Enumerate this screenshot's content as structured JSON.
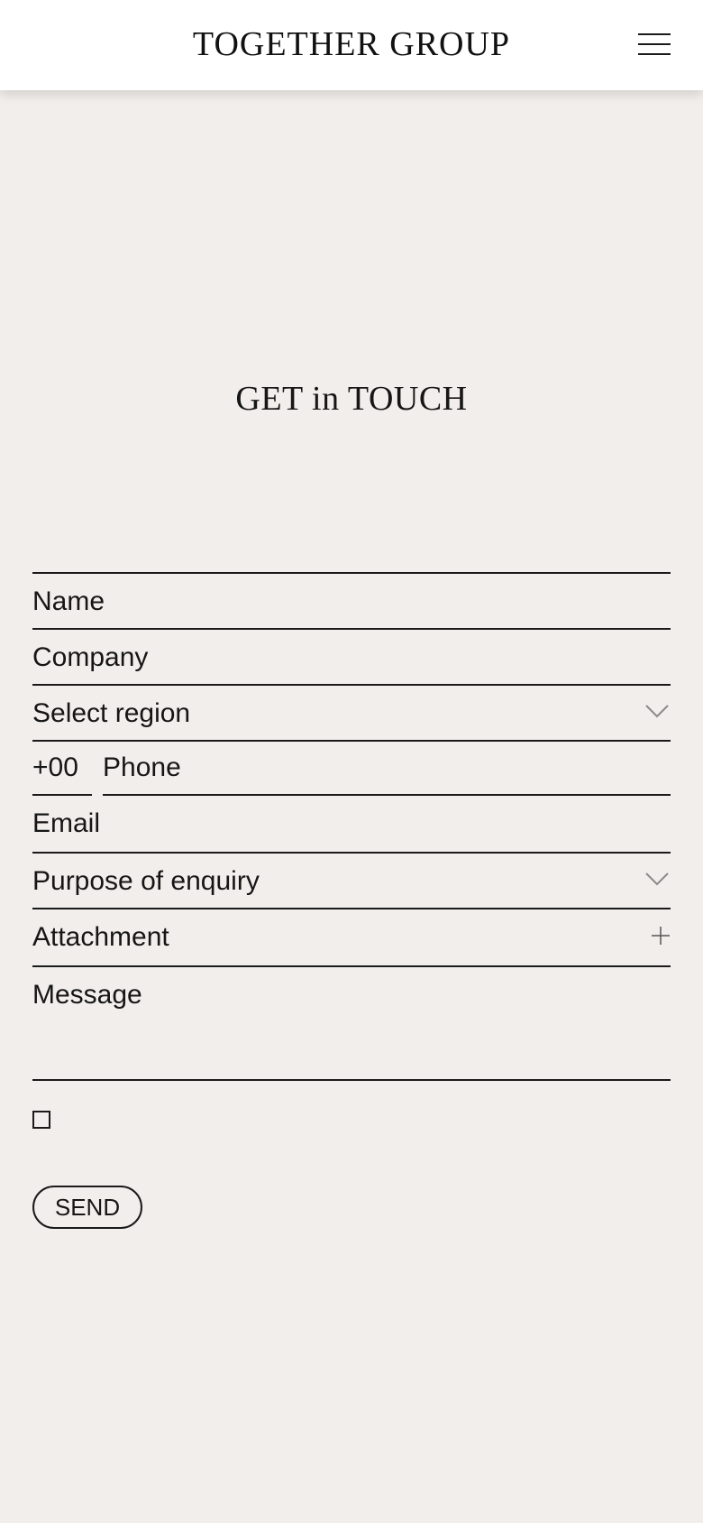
{
  "header": {
    "brand": "TOGETHER GROUP",
    "menu_icon": "hamburger-menu-icon"
  },
  "page": {
    "title": "GET in TOUCH"
  },
  "form": {
    "name": "Name",
    "company": "Company",
    "region": "Select region",
    "region_icon": "chevron-down-icon",
    "phone_code": "+00",
    "phone": "Phone",
    "email": "Email",
    "purpose": "Purpose of enquiry",
    "purpose_icon": "chevron-down-icon",
    "attachment": "Attachment",
    "attachment_icon": "plus-icon",
    "message": "Message",
    "consent_checked": false,
    "send": "SEND"
  },
  "colors": {
    "background": "#f2eeeb",
    "header": "#ffffff",
    "text": "#161616",
    "icon_gray": "#8a8a8a"
  }
}
